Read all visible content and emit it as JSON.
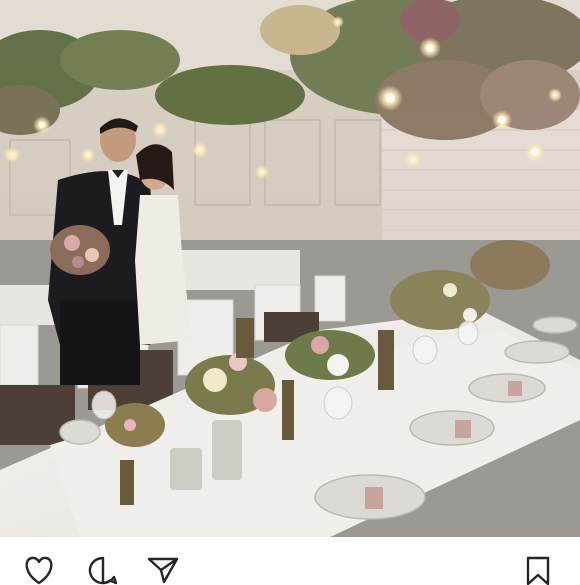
{
  "post": {
    "photo_alt": "",
    "actions": [
      {
        "name": "like",
        "icon": "heart-icon"
      },
      {
        "name": "comment",
        "icon": "comment-icon"
      },
      {
        "name": "share",
        "icon": "send-icon"
      },
      {
        "name": "save",
        "icon": "bookmark-icon"
      }
    ]
  },
  "colors": {
    "background": "#ffffff",
    "icon_stroke": "#262626"
  }
}
